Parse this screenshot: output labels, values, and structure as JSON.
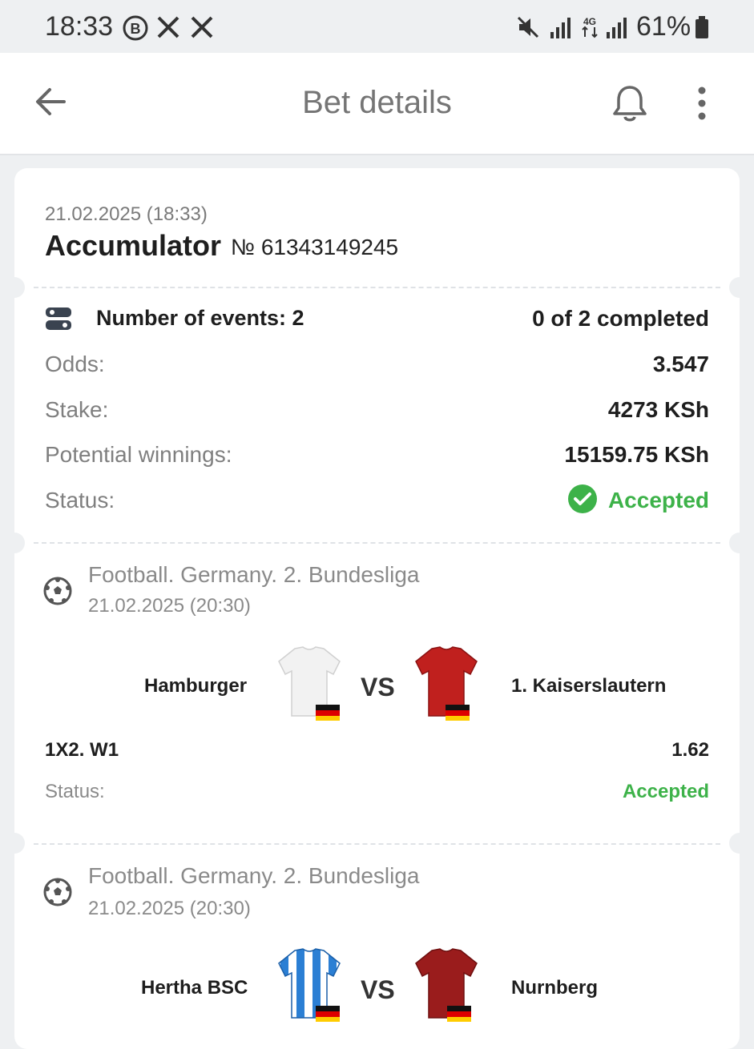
{
  "status_bar": {
    "time": "18:33",
    "battery": "61%",
    "icons": [
      "b-badge-icon",
      "x-icon",
      "x-icon",
      "mute-icon",
      "signal-icon",
      "4g-icon",
      "signal-icon",
      "battery-icon"
    ]
  },
  "appbar": {
    "title": "Bet details",
    "back_icon": "arrow-left-icon",
    "bell_icon": "bell-icon",
    "menu_icon": "more-vert-icon"
  },
  "bet": {
    "date": "21.02.2025 (18:33)",
    "type": "Accumulator",
    "number": "№ 61343149245",
    "events_label": "Number of events: 2",
    "completed": "0 of 2 completed",
    "odds_label": "Odds:",
    "odds_value": "3.547",
    "stake_label": "Stake:",
    "stake_value": "4273 KSh",
    "winnings_label": "Potential winnings:",
    "winnings_value": "15159.75 KSh",
    "status_label": "Status:",
    "status_value": "Accepted",
    "accent_green": "#3db249"
  },
  "events": [
    {
      "league": "Football. Germany. 2. Bundesliga",
      "date": "21.02.2025 (20:30)",
      "home": "Hamburger",
      "away": "1. Kaiserslautern",
      "vs": "VS",
      "market": "1X2. W1",
      "odd": "1.62",
      "status_label": "Status:",
      "status_value": "Accepted",
      "home_kit_color": "#f2f2f2",
      "away_kit_color": "#c0201e"
    },
    {
      "league": "Football. Germany. 2. Bundesliga",
      "date": "21.02.2025 (20:30)",
      "home": "Hertha BSC",
      "away": "Nurnberg",
      "vs": "VS",
      "home_kit_color": "#2b7fd4",
      "away_kit_color": "#9a1c1c"
    }
  ]
}
